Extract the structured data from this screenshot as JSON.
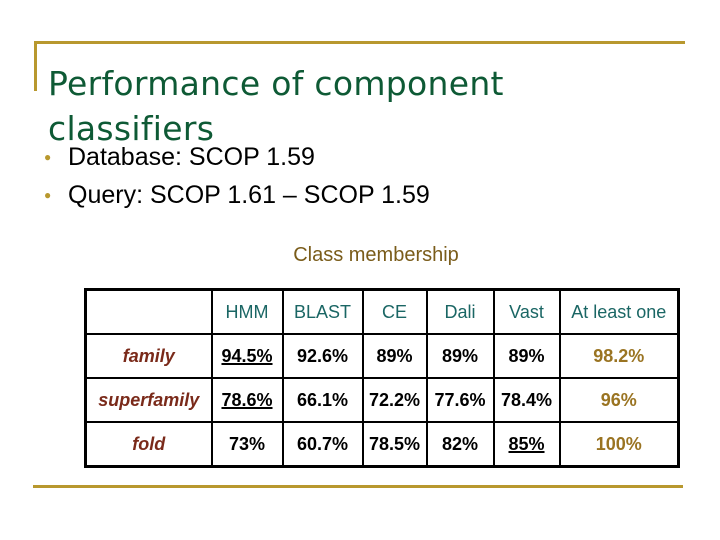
{
  "slide": {
    "title_line1": "Performance of component",
    "title_line2": "classifiers",
    "bullets": [
      "Database: SCOP 1.59",
      "Query: SCOP 1.61 – SCOP 1.59"
    ],
    "table_caption": "Class membership"
  },
  "table": {
    "headers": [
      "",
      "HMM",
      "BLAST",
      "CE",
      "Dali",
      "Vast",
      "At least one"
    ],
    "rows": [
      {
        "label": "family",
        "values": [
          "94.5%",
          "92.6%",
          "89%",
          "89%",
          "89%",
          "98.2%"
        ],
        "underlined": [
          "94.5%"
        ]
      },
      {
        "label": "superfamily",
        "values": [
          "78.6%",
          "66.1%",
          "72.2%",
          "77.6%",
          "78.4%",
          "96%"
        ],
        "underlined": [
          "78.6%"
        ]
      },
      {
        "label": "fold",
        "values": [
          "73%",
          "60.7%",
          "78.5%",
          "82%",
          "85%",
          "100%"
        ],
        "underlined": [
          "85%"
        ]
      }
    ]
  },
  "colors": {
    "title": "#0e5a35",
    "accent_rule": "#b8982e",
    "caption": "#7a5c1a",
    "header_text": "#1a6664",
    "row_label": "#7a2a1a",
    "at_least_one": "#9a7422"
  }
}
